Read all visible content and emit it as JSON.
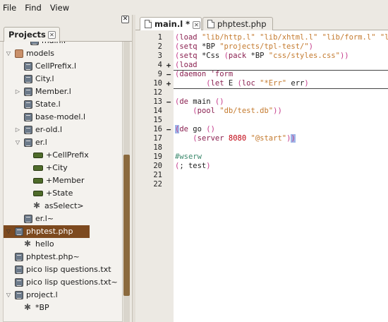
{
  "menu": {
    "file": "File",
    "find": "Find",
    "view": "View"
  },
  "left_panel": {
    "close_glyph": "✕",
    "tab_label": "Projects",
    "tab_close_glyph": "✕",
    "partial_top": "main.l",
    "tree": [
      {
        "label": "models",
        "icon": "folder-icon",
        "expander": "▽",
        "selected": false
      },
      {
        "label": "CellPrefix.l",
        "icon": "file-icon",
        "expander": "",
        "selected": false
      },
      {
        "label": "City.l",
        "icon": "file-icon",
        "expander": "",
        "selected": false
      },
      {
        "label": "Member.l",
        "icon": "file-icon",
        "expander": "▷",
        "selected": false
      },
      {
        "label": "State.l",
        "icon": "file-icon",
        "expander": "",
        "selected": false
      },
      {
        "label": "base-model.l",
        "icon": "file-icon",
        "expander": "",
        "selected": false
      },
      {
        "label": "er-old.l",
        "icon": "file-icon",
        "expander": "▷",
        "selected": false
      },
      {
        "label": "er.l",
        "icon": "file-icon",
        "expander": "▽",
        "selected": false
      },
      {
        "label": "+CellPrefix",
        "icon": "symbol-icon",
        "expander": "",
        "selected": false
      },
      {
        "label": "+City",
        "icon": "symbol-icon",
        "expander": "",
        "selected": false
      },
      {
        "label": "+Member",
        "icon": "symbol-icon",
        "expander": "",
        "selected": false
      },
      {
        "label": "+State",
        "icon": "symbol-icon",
        "expander": "",
        "selected": false
      },
      {
        "label": "asSelect>",
        "icon": "gear-icon",
        "expander": "",
        "selected": false
      },
      {
        "label": "er.l~",
        "icon": "file-icon",
        "expander": "",
        "selected": false
      },
      {
        "label": "phptest.php",
        "icon": "file-icon",
        "expander": "▽",
        "selected": true
      },
      {
        "label": "hello",
        "icon": "gear-icon",
        "expander": "",
        "selected": false
      },
      {
        "label": "phptest.php~",
        "icon": "file-icon",
        "expander": "",
        "selected": false
      },
      {
        "label": "pico lisp questions.txt",
        "icon": "file-icon",
        "expander": "",
        "selected": false
      },
      {
        "label": "pico lisp questions.txt~",
        "icon": "file-icon",
        "expander": "",
        "selected": false
      },
      {
        "label": "project.l",
        "icon": "file-icon",
        "expander": "▽",
        "selected": false
      },
      {
        "label": "*BP",
        "icon": "gear-icon",
        "expander": "",
        "selected": false
      }
    ]
  },
  "editor": {
    "tabs": [
      {
        "label": "main.l *",
        "close_glyph": "✕",
        "active": true
      },
      {
        "label": "phptest.php",
        "close_glyph": "",
        "active": false
      }
    ],
    "lines": [
      {
        "n": "1",
        "fold": "",
        "text": "(load \"lib/http.l\" \"lib/xhtml.l\" \"lib/form.l\" \"lib/ps.l\")"
      },
      {
        "n": "2",
        "fold": "",
        "text": "(setq *BP \"projects/tpl-test/\")"
      },
      {
        "n": "3",
        "fold": "",
        "text": "(setq *Css (pack *BP \"css/styles.css\"))"
      },
      {
        "n": "4",
        "fold": "+",
        "text": "(load"
      },
      {
        "n": "9",
        "fold": "−",
        "text": "(daemon 'form"
      },
      {
        "n": "10",
        "fold": "+",
        "text": "       (let E (loc \"*Err\" err)"
      },
      {
        "n": "12",
        "fold": "",
        "text": ""
      },
      {
        "n": "13",
        "fold": "−",
        "text": "(de main ()"
      },
      {
        "n": "14",
        "fold": "",
        "text": "    (pool \"db/test.db\"))"
      },
      {
        "n": "15",
        "fold": "",
        "text": ""
      },
      {
        "n": "16",
        "fold": "−",
        "text": "(de go ()"
      },
      {
        "n": "17",
        "fold": "",
        "text": "    (server 8080 \"@start\"))"
      },
      {
        "n": "18",
        "fold": "",
        "text": ""
      },
      {
        "n": "19",
        "fold": "",
        "text": "#wserw"
      },
      {
        "n": "20",
        "fold": "",
        "text": "(; test)"
      },
      {
        "n": "21",
        "fold": "",
        "text": ""
      },
      {
        "n": "22",
        "fold": "",
        "text": ""
      }
    ]
  },
  "colors": {
    "string": "#c47a2e",
    "paren": "#c43a8a",
    "keyword": "#8a2050",
    "number": "#c0000e",
    "comment": "#3d8a6e",
    "selection": "#7d4a1f",
    "bracket_highlight": "#9fb5e8"
  }
}
